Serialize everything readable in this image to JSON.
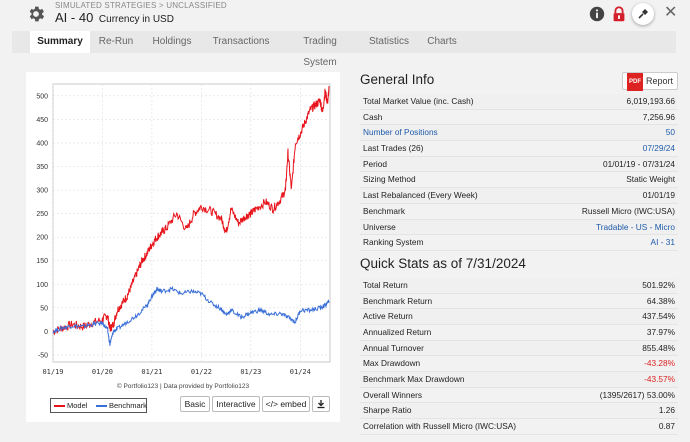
{
  "header": {
    "breadcrumb": "SIMULATED STRATEGIES > UNCLASSIFIED",
    "title": "AI - 40",
    "subtitle": "Currency in USD"
  },
  "tabs": [
    {
      "label": "Summary",
      "active": true
    },
    {
      "label": "Re-Run"
    },
    {
      "label": "Holdings"
    },
    {
      "label": "Transactions"
    },
    {
      "label": "Trading System"
    },
    {
      "label": "Statistics"
    },
    {
      "label": "Charts"
    }
  ],
  "chart_data": {
    "type": "line",
    "x_tick_labels": [
      "01/19",
      "01/20",
      "01/21",
      "01/22",
      "01/23",
      "01/24"
    ],
    "y_ticks": [
      -50,
      0,
      50,
      100,
      150,
      200,
      250,
      300,
      350,
      400,
      450,
      500
    ],
    "ylim": [
      -65,
      525
    ],
    "grid": true,
    "legend_position": "bottom-left",
    "series": [
      {
        "name": "Model",
        "color": "#e8141c",
        "x": [
          2019.0,
          2019.2,
          2019.4,
          2019.6,
          2019.8,
          2020.0,
          2020.1,
          2020.15,
          2020.22,
          2020.3,
          2020.4,
          2020.5,
          2020.6,
          2020.7,
          2020.8,
          2020.9,
          2021.0,
          2021.1,
          2021.2,
          2021.3,
          2021.5,
          2021.7,
          2021.85,
          2022.0,
          2022.2,
          2022.4,
          2022.5,
          2022.6,
          2022.75,
          2022.9,
          2023.0,
          2023.1,
          2023.3,
          2023.45,
          2023.6,
          2023.7,
          2023.75,
          2023.82,
          2023.9,
          2024.0,
          2024.1,
          2024.2,
          2024.3,
          2024.4,
          2024.45,
          2024.5,
          2024.55,
          2024.58
        ],
        "y": [
          0,
          8,
          15,
          10,
          18,
          25,
          35,
          5,
          15,
          45,
          60,
          75,
          100,
          125,
          150,
          165,
          185,
          200,
          210,
          220,
          250,
          215,
          250,
          265,
          255,
          240,
          210,
          260,
          230,
          245,
          250,
          260,
          275,
          260,
          280,
          300,
          380,
          300,
          400,
          420,
          445,
          470,
          480,
          490,
          465,
          510,
          485,
          515
        ]
      },
      {
        "name": "Benchmark",
        "color": "#3a6fd8",
        "x": [
          2019.0,
          2019.2,
          2019.4,
          2019.6,
          2019.8,
          2020.0,
          2020.1,
          2020.15,
          2020.22,
          2020.3,
          2020.5,
          2020.7,
          2020.9,
          2021.0,
          2021.1,
          2021.2,
          2021.4,
          2021.6,
          2021.8,
          2022.0,
          2022.2,
          2022.4,
          2022.5,
          2022.6,
          2022.8,
          2023.0,
          2023.2,
          2023.4,
          2023.6,
          2023.75,
          2023.9,
          2024.0,
          2024.2,
          2024.4,
          2024.5,
          2024.58
        ],
        "y": [
          0,
          8,
          12,
          10,
          15,
          18,
          5,
          -28,
          0,
          5,
          20,
          35,
          55,
          75,
          90,
          85,
          90,
          80,
          85,
          80,
          60,
          48,
          35,
          45,
          30,
          40,
          45,
          35,
          38,
          30,
          20,
          45,
          45,
          50,
          55,
          64
        ]
      }
    ]
  },
  "chart": {
    "credit": "© Portfolio123 | Data provided by Portfolio123",
    "buttons": {
      "basic": "Basic",
      "interactive": "Interactive",
      "embed": "</> embed"
    }
  },
  "general_info": {
    "title": "General Info",
    "report_label": "Report",
    "pdf_label": "PDF",
    "rows": [
      {
        "label": "Total Market Value (inc. Cash)",
        "value": "6,019,193.66",
        "label_link": false,
        "value_link": false
      },
      {
        "label": "Cash",
        "value": "7,256.96",
        "label_link": false,
        "value_link": false
      },
      {
        "label": "Number of Positions",
        "value": "50",
        "label_link": true,
        "value_link": true
      },
      {
        "label": "Last Trades (26)",
        "value": "07/29/24",
        "label_link": "partial",
        "value_link": true
      },
      {
        "label": "Period",
        "value": "01/01/19 - 07/31/24",
        "label_link": false,
        "value_link": false
      },
      {
        "label": "Sizing Method",
        "value": "Static Weight",
        "label_link": false,
        "value_link": false
      },
      {
        "label": "Last Rebalanced (Every Week)",
        "value": "01/01/19",
        "label_link": false,
        "value_link": false
      },
      {
        "label": "Benchmark",
        "value": "Russell Micro (IWC:USA)",
        "label_link": false,
        "value_link": false
      },
      {
        "label": "Universe",
        "value": "Tradable - US - Micro",
        "label_link": false,
        "value_link": true
      },
      {
        "label": "Ranking System",
        "value": "AI - 31",
        "label_link": false,
        "value_link": true
      }
    ]
  },
  "quick_stats": {
    "title": "Quick Stats as of 7/31/2024",
    "rows": [
      {
        "label": "Total Return",
        "value": "501.92%",
        "negative": false
      },
      {
        "label": "Benchmark Return",
        "value": "64.38%",
        "negative": false
      },
      {
        "label": "Active Return",
        "value": "437.54%",
        "negative": false
      },
      {
        "label": "Annualized Return",
        "value": "37.97%",
        "negative": false
      },
      {
        "label": "Annual Turnover",
        "value": "855.48%",
        "negative": false
      },
      {
        "label": "Max Drawdown",
        "value": "-43.28%",
        "negative": true
      },
      {
        "label": "Benchmark Max Drawdown",
        "value": "-43.57%",
        "negative": true
      },
      {
        "label": "Overall Winners",
        "value": "(1395/2617) 53.00%",
        "negative": false
      },
      {
        "label": "Sharpe Ratio",
        "value": "1.26",
        "negative": false
      },
      {
        "label": "Correlation with Russell Micro (IWC:USA)",
        "value": "0.87",
        "negative": false
      }
    ]
  }
}
